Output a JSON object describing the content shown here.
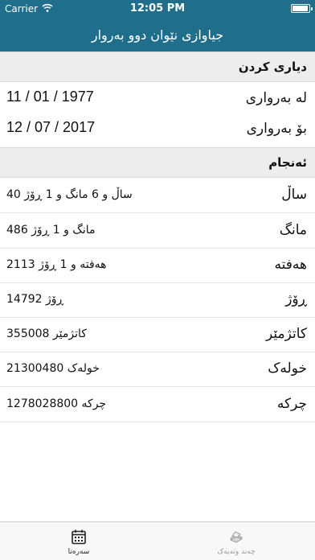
{
  "status_bar": {
    "carrier": "Carrier",
    "time": "12:05 PM"
  },
  "nav": {
    "title": "جیاوازی نێوان دوو بەروار"
  },
  "input_section": {
    "header": "دیاری کردن",
    "from": {
      "label": "لە بەرواری",
      "value": "11 / 01 / 1977"
    },
    "to": {
      "label": "بۆ بەرواری",
      "value": "12 / 07 / 2017"
    }
  },
  "result_section": {
    "header": "ئەنجام",
    "rows": [
      {
        "label": "ساڵ",
        "value": "40 ساڵ و 6 مانگ و 1 ڕۆژ"
      },
      {
        "label": "مانگ",
        "value": "486 مانگ و 1 ڕۆژ"
      },
      {
        "label": "هەفتە",
        "value": "2113 هەفتە و 1 ڕۆژ"
      },
      {
        "label": "ڕۆژ",
        "value": "14792 ڕۆژ"
      },
      {
        "label": "کاتژمێر",
        "value": "355008 کاتژمێر"
      },
      {
        "label": "خولەک",
        "value": "21300480 خولەک"
      },
      {
        "label": "چرکە",
        "value": "1278028800 چرکە"
      }
    ]
  },
  "tab_bar": {
    "home": {
      "label": "سەرەتا",
      "icon": "calendar-icon"
    },
    "more": {
      "label": "چەند وتەیەک",
      "icon": "papers-icon"
    }
  },
  "colors": {
    "accent": "#1f6e8c",
    "section_bg": "#ededed"
  }
}
